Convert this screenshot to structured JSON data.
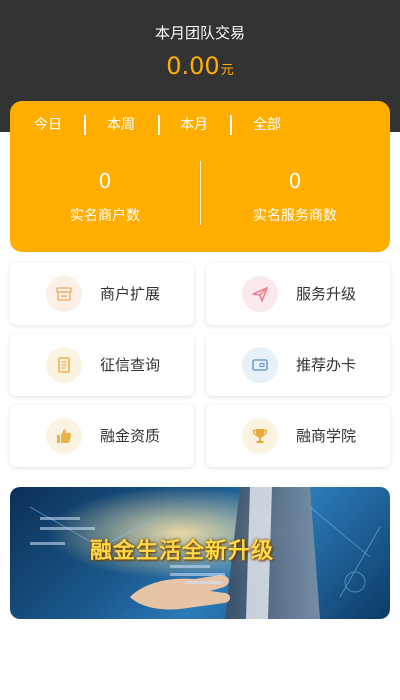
{
  "header": {
    "title": "本月团队交易",
    "amount": "0.00",
    "unit": "元"
  },
  "stats_card": {
    "tabs": [
      {
        "label": "今日"
      },
      {
        "label": "本周"
      },
      {
        "label": "本月"
      },
      {
        "label": "全部"
      }
    ],
    "stats": [
      {
        "value": "0",
        "label": "实名商户数"
      },
      {
        "value": "0",
        "label": "实名服务商数"
      }
    ]
  },
  "grid": {
    "items": [
      {
        "label": "商户扩展",
        "icon": "store-icon"
      },
      {
        "label": "服务升级",
        "icon": "paper-plane-icon"
      },
      {
        "label": "征信查询",
        "icon": "document-icon"
      },
      {
        "label": "推荐办卡",
        "icon": "card-icon"
      },
      {
        "label": "融金资质",
        "icon": "thumbs-up-icon"
      },
      {
        "label": "融商学院",
        "icon": "trophy-icon"
      }
    ]
  },
  "banner": {
    "text": "融金生活全新升级"
  },
  "colors": {
    "accent": "#ffae00",
    "header_bg": "#333333"
  }
}
